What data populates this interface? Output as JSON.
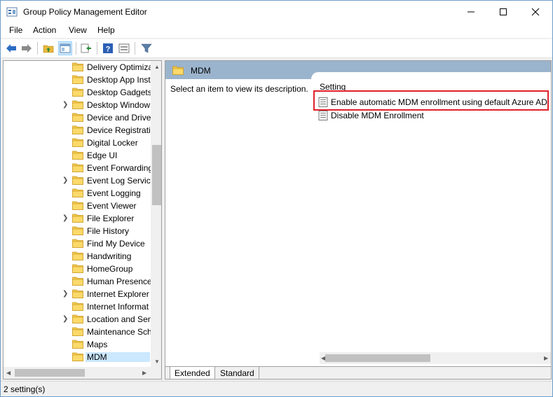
{
  "window": {
    "title": "Group Policy Management Editor"
  },
  "menu": {
    "file": "File",
    "action": "Action",
    "view": "View",
    "help": "Help"
  },
  "toolbar": {
    "icons": [
      "back-icon",
      "forward-icon",
      "up-folder-icon",
      "show-hide-tree-icon",
      "export-icon",
      "help-icon",
      "properties-icon",
      "filter-icon"
    ]
  },
  "tree": {
    "items": [
      {
        "label": "Delivery Optimiza",
        "expandable": false
      },
      {
        "label": "Desktop App Inst",
        "expandable": false
      },
      {
        "label": "Desktop Gadgets",
        "expandable": false
      },
      {
        "label": "Desktop Window",
        "expandable": true
      },
      {
        "label": "Device and Drive",
        "expandable": false
      },
      {
        "label": "Device Registratio",
        "expandable": false
      },
      {
        "label": "Digital Locker",
        "expandable": false
      },
      {
        "label": "Edge UI",
        "expandable": false
      },
      {
        "label": "Event Forwarding",
        "expandable": false
      },
      {
        "label": "Event Log Service",
        "expandable": true
      },
      {
        "label": "Event Logging",
        "expandable": false
      },
      {
        "label": "Event Viewer",
        "expandable": false
      },
      {
        "label": "File Explorer",
        "expandable": true
      },
      {
        "label": "File History",
        "expandable": false
      },
      {
        "label": "Find My Device",
        "expandable": false
      },
      {
        "label": "Handwriting",
        "expandable": false
      },
      {
        "label": "HomeGroup",
        "expandable": false
      },
      {
        "label": "Human Presence",
        "expandable": false
      },
      {
        "label": "Internet Explorer",
        "expandable": true
      },
      {
        "label": "Internet Informat",
        "expandable": false
      },
      {
        "label": "Location and Sen",
        "expandable": true
      },
      {
        "label": "Maintenance Sch",
        "expandable": false
      },
      {
        "label": "Maps",
        "expandable": false
      },
      {
        "label": "MDM",
        "expandable": false,
        "selected": true
      }
    ]
  },
  "right_pane": {
    "header": "MDM",
    "description": "Select an item to view its description.",
    "column_header": "Setting",
    "settings": [
      "Enable automatic MDM enrollment using default Azure AD",
      "Disable MDM Enrollment"
    ],
    "tabs": [
      "Extended",
      "Standard"
    ]
  },
  "status": {
    "text": "2 setting(s)"
  },
  "colors": {
    "header_band": "#9bb4cd",
    "selection": "#cce8ff",
    "highlight": "#e0202a",
    "folder": "#f4c84a"
  }
}
